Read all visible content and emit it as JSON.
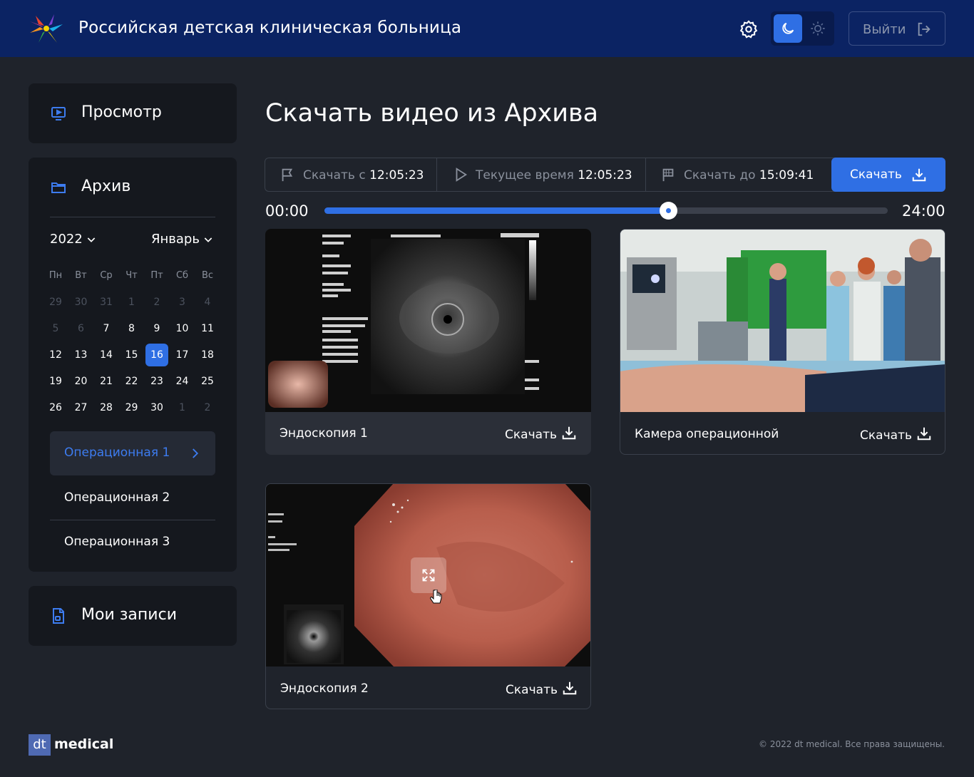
{
  "header": {
    "title": "Российская детская клиническая больница",
    "logout_label": "Выйти"
  },
  "sidebar": {
    "view_label": "Просмотр",
    "archive_label": "Архив",
    "records_label": "Мои записи",
    "year": "2022",
    "month": "Январь",
    "weekdays": [
      "Пн",
      "Вт",
      "Ср",
      "Чт",
      "Пт",
      "Сб",
      "Вс"
    ],
    "calendar": [
      [
        {
          "d": "29",
          "m": true
        },
        {
          "d": "30",
          "m": true
        },
        {
          "d": "31",
          "m": true
        },
        {
          "d": "1",
          "m": true
        },
        {
          "d": "2",
          "m": true
        },
        {
          "d": "3",
          "m": true
        },
        {
          "d": "4",
          "m": true
        }
      ],
      [
        {
          "d": "5",
          "m": true
        },
        {
          "d": "6",
          "m": true
        },
        {
          "d": "7"
        },
        {
          "d": "8"
        },
        {
          "d": "9"
        },
        {
          "d": "10"
        },
        {
          "d": "11"
        }
      ],
      [
        {
          "d": "12"
        },
        {
          "d": "13"
        },
        {
          "d": "14"
        },
        {
          "d": "15"
        },
        {
          "d": "16",
          "sel": true
        },
        {
          "d": "17"
        },
        {
          "d": "18"
        }
      ],
      [
        {
          "d": "19"
        },
        {
          "d": "20"
        },
        {
          "d": "21"
        },
        {
          "d": "22"
        },
        {
          "d": "23"
        },
        {
          "d": "24"
        },
        {
          "d": "25"
        }
      ],
      [
        {
          "d": "26"
        },
        {
          "d": "27"
        },
        {
          "d": "28"
        },
        {
          "d": "29"
        },
        {
          "d": "30"
        },
        {
          "d": "1",
          "m": true
        },
        {
          "d": "2",
          "m": true
        }
      ]
    ],
    "rooms": [
      "Операционная 1",
      "Операционная 2",
      "Операционная 3"
    ]
  },
  "main": {
    "title": "Скачать видео из Архива",
    "from_label": "Скачать с",
    "from_time": "12:05:23",
    "current_label": "Текущее время",
    "current_time": "12:05:23",
    "to_label": "Скачать до",
    "to_time": "15:09:41",
    "download_label": "Скачать",
    "time_start": "00:00",
    "time_end": "24:00",
    "progress_fraction": 0.61
  },
  "videos": [
    {
      "name": "Эндоскопия 1",
      "action": "Скачать"
    },
    {
      "name": "Камера операционной",
      "action": "Скачать"
    },
    {
      "name": "Эндоскопия 2",
      "action": "Скачать"
    }
  ],
  "footer": {
    "brand_short": "dt",
    "brand_name": "medical",
    "copyright": "© 2022 dt medical. Все права защищены."
  },
  "colors": {
    "accent": "#2f6fe4",
    "header_bg": "#0b2363",
    "page_bg": "#1f232b",
    "card_bg": "#15181e"
  },
  "icons": [
    "logo-icon",
    "gear-icon",
    "moon-icon",
    "sun-icon",
    "logout-icon",
    "play-screen-icon",
    "folder-icon",
    "document-icon",
    "chevron-down-icon",
    "chevron-right-icon",
    "flag-icon",
    "play-icon",
    "finish-flag-icon",
    "download-icon",
    "expand-icon",
    "cursor-icon"
  ]
}
